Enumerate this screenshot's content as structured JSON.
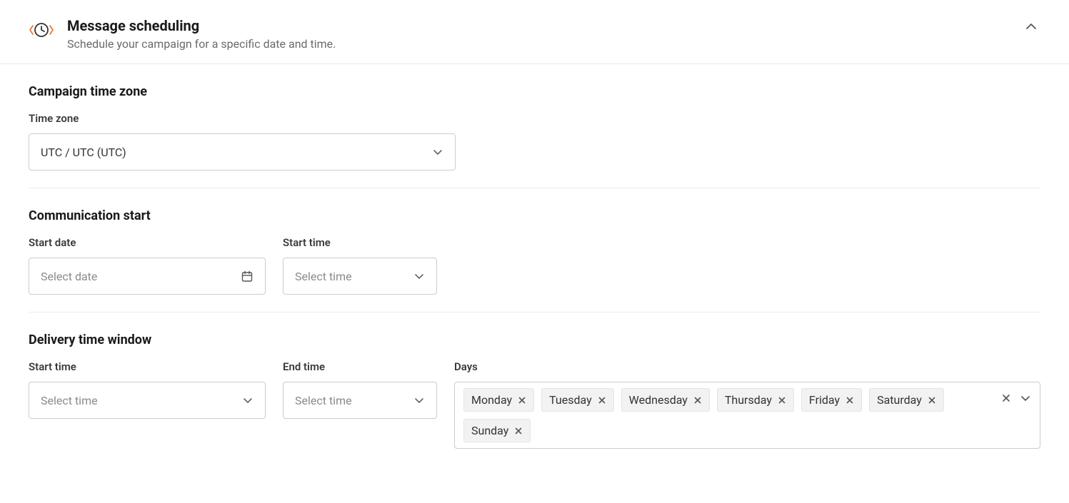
{
  "header": {
    "title": "Message scheduling",
    "subtitle": "Schedule your campaign for a specific date and time."
  },
  "timezone": {
    "section_title": "Campaign time zone",
    "label": "Time zone",
    "value": "UTC / UTC (UTC)"
  },
  "communication_start": {
    "section_title": "Communication start",
    "start_date_label": "Start date",
    "start_date_placeholder": "Select date",
    "start_time_label": "Start time",
    "start_time_placeholder": "Select time"
  },
  "delivery_window": {
    "section_title": "Delivery time window",
    "start_time_label": "Start time",
    "start_time_placeholder": "Select time",
    "end_time_label": "End time",
    "end_time_placeholder": "Select time",
    "days_label": "Days",
    "days": [
      "Monday",
      "Tuesday",
      "Wednesday",
      "Thursday",
      "Friday",
      "Saturday",
      "Sunday"
    ]
  }
}
